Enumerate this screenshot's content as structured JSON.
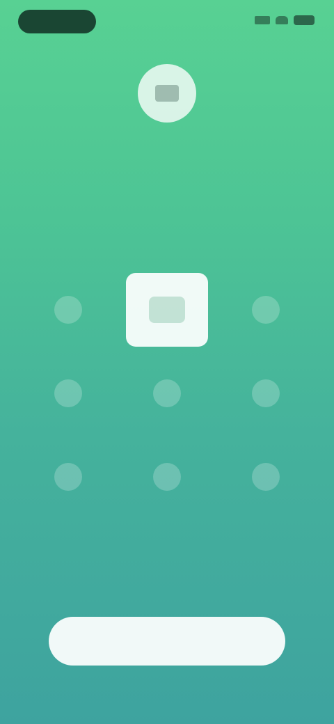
{
  "header": {
    "title": "",
    "subtitle": ""
  },
  "grid": {
    "tiles": [
      {
        "icon": "option-icon",
        "selected": false
      },
      {
        "icon": "option-icon",
        "selected": true
      },
      {
        "icon": "option-icon",
        "selected": false
      },
      {
        "icon": "option-icon",
        "selected": false
      },
      {
        "icon": "option-icon",
        "selected": false
      },
      {
        "icon": "option-icon",
        "selected": false
      },
      {
        "icon": "option-icon",
        "selected": false
      },
      {
        "icon": "option-icon",
        "selected": false
      },
      {
        "icon": "option-icon",
        "selected": false
      }
    ]
  },
  "footer": {
    "button_label": ""
  },
  "colors": {
    "gradient_top": "#58d193",
    "gradient_bottom": "#3ea39f",
    "accent": "#3e8f79"
  }
}
